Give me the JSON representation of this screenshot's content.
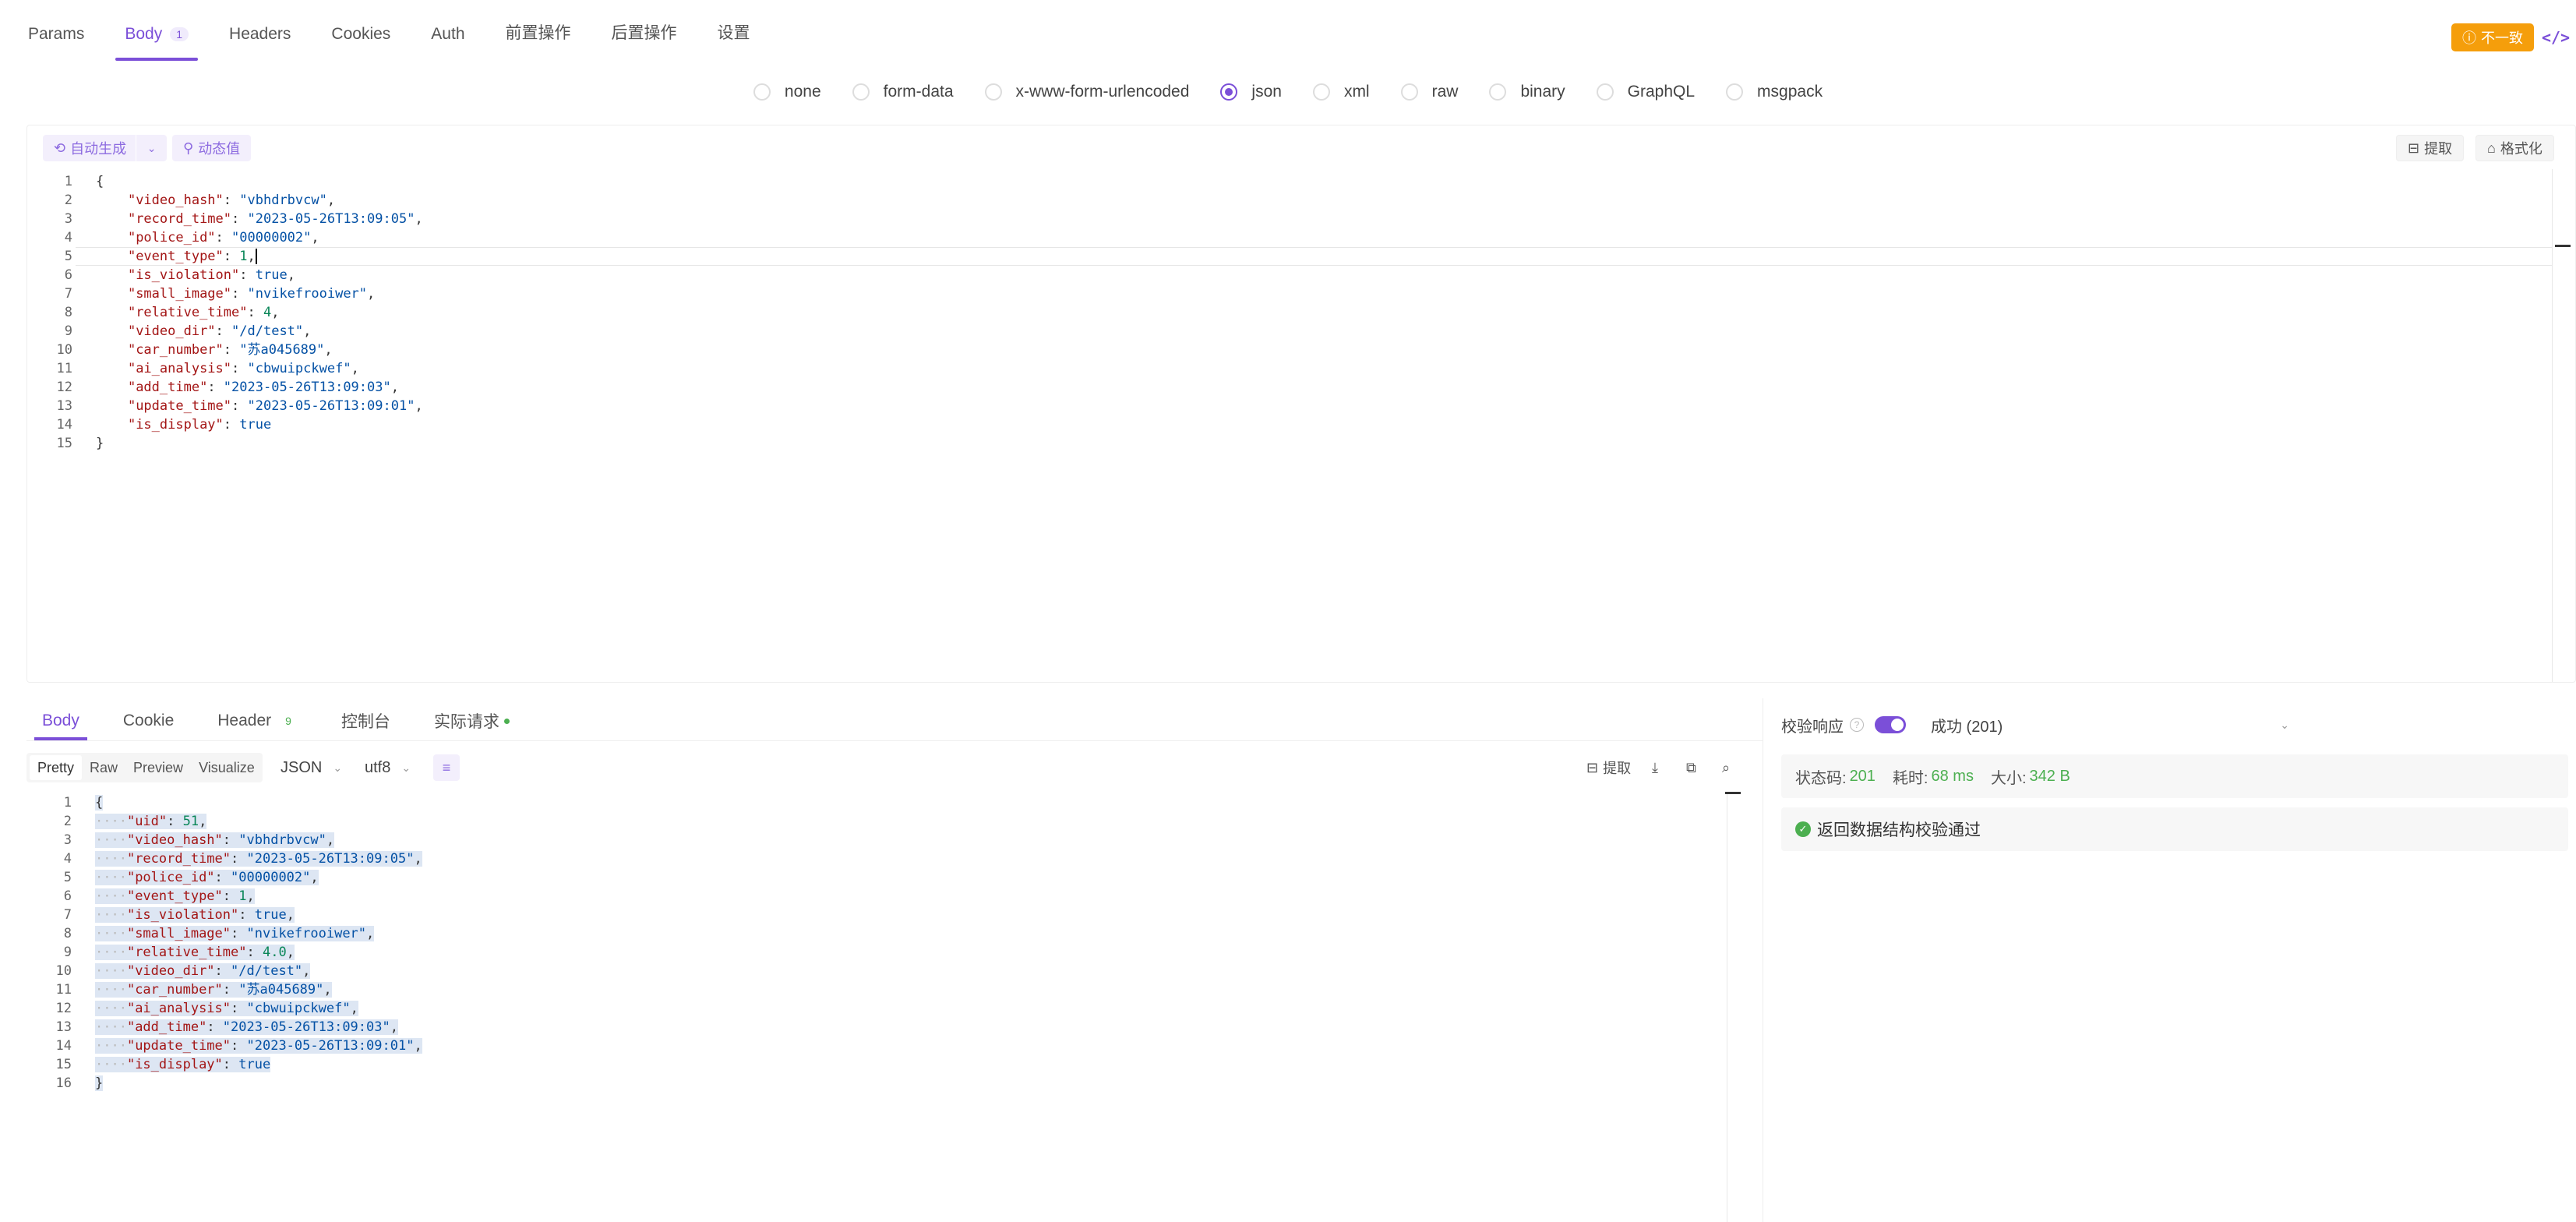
{
  "request_tabs": [
    {
      "label": "Params"
    },
    {
      "label": "Body",
      "count": "1",
      "active": true
    },
    {
      "label": "Headers"
    },
    {
      "label": "Cookies"
    },
    {
      "label": "Auth"
    },
    {
      "label": "前置操作"
    },
    {
      "label": "后置操作"
    },
    {
      "label": "设置"
    }
  ],
  "header_actions": {
    "inconsistent_label": "不一致",
    "code_icon": "code-icon"
  },
  "body_types": [
    "none",
    "form-data",
    "x-www-form-urlencoded",
    "json",
    "xml",
    "raw",
    "binary",
    "GraphQL",
    "msgpack"
  ],
  "body_type_selected": "json",
  "editor_toolbar": {
    "auto_generate": "自动生成",
    "dynamic_value": "动态值",
    "extract": "提取",
    "format": "格式化"
  },
  "request_body_lines": [
    [
      [
        "p",
        "{"
      ]
    ],
    [
      [
        "p",
        "    "
      ],
      [
        "k",
        "\"video_hash\""
      ],
      [
        "p",
        ": "
      ],
      [
        "s",
        "\"vbhdrbvcw\""
      ],
      [
        "p",
        ","
      ]
    ],
    [
      [
        "p",
        "    "
      ],
      [
        "k",
        "\"record_time\""
      ],
      [
        "p",
        ": "
      ],
      [
        "s",
        "\"2023-05-26T13:09:05\""
      ],
      [
        "p",
        ","
      ]
    ],
    [
      [
        "p",
        "    "
      ],
      [
        "k",
        "\"police_id\""
      ],
      [
        "p",
        ": "
      ],
      [
        "s",
        "\"00000002\""
      ],
      [
        "p",
        ","
      ]
    ],
    [
      [
        "p",
        "    "
      ],
      [
        "k",
        "\"event_type\""
      ],
      [
        "p",
        ": "
      ],
      [
        "n",
        "1"
      ],
      [
        "p",
        ","
      ]
    ],
    [
      [
        "p",
        "    "
      ],
      [
        "k",
        "\"is_violation\""
      ],
      [
        "p",
        ": "
      ],
      [
        "b",
        "true"
      ],
      [
        "p",
        ","
      ]
    ],
    [
      [
        "p",
        "    "
      ],
      [
        "k",
        "\"small_image\""
      ],
      [
        "p",
        ": "
      ],
      [
        "s",
        "\"nvikefrooiwer\""
      ],
      [
        "p",
        ","
      ]
    ],
    [
      [
        "p",
        "    "
      ],
      [
        "k",
        "\"relative_time\""
      ],
      [
        "p",
        ": "
      ],
      [
        "n",
        "4"
      ],
      [
        "p",
        ","
      ]
    ],
    [
      [
        "p",
        "    "
      ],
      [
        "k",
        "\"video_dir\""
      ],
      [
        "p",
        ": "
      ],
      [
        "s",
        "\"/d/test\""
      ],
      [
        "p",
        ","
      ]
    ],
    [
      [
        "p",
        "    "
      ],
      [
        "k",
        "\"car_number\""
      ],
      [
        "p",
        ": "
      ],
      [
        "s",
        "\"苏a045689\""
      ],
      [
        "p",
        ","
      ]
    ],
    [
      [
        "p",
        "    "
      ],
      [
        "k",
        "\"ai_analysis\""
      ],
      [
        "p",
        ": "
      ],
      [
        "s",
        "\"cbwuipckwef\""
      ],
      [
        "p",
        ","
      ]
    ],
    [
      [
        "p",
        "    "
      ],
      [
        "k",
        "\"add_time\""
      ],
      [
        "p",
        ": "
      ],
      [
        "s",
        "\"2023-05-26T13:09:03\""
      ],
      [
        "p",
        ","
      ]
    ],
    [
      [
        "p",
        "    "
      ],
      [
        "k",
        "\"update_time\""
      ],
      [
        "p",
        ": "
      ],
      [
        "s",
        "\"2023-05-26T13:09:01\""
      ],
      [
        "p",
        ","
      ]
    ],
    [
      [
        "p",
        "    "
      ],
      [
        "k",
        "\"is_display\""
      ],
      [
        "p",
        ": "
      ],
      [
        "b",
        "true"
      ]
    ],
    [
      [
        "p",
        "}"
      ]
    ]
  ],
  "response_tabs": [
    {
      "label": "Body",
      "active": true
    },
    {
      "label": "Cookie"
    },
    {
      "label": "Header",
      "count": "9"
    },
    {
      "label": "控制台"
    },
    {
      "label": "实际请求",
      "dot": true
    }
  ],
  "view_modes": [
    "Pretty",
    "Raw",
    "Preview",
    "Visualize"
  ],
  "format_select": "JSON",
  "encoding_select": "utf8",
  "response_tools": {
    "extract": "提取"
  },
  "response_body_lines": [
    [
      [
        "p",
        "{"
      ]
    ],
    [
      [
        "d",
        "····"
      ],
      [
        "k",
        "\"uid\""
      ],
      [
        "p",
        ": "
      ],
      [
        "n",
        "51"
      ],
      [
        "p",
        ","
      ]
    ],
    [
      [
        "d",
        "····"
      ],
      [
        "k",
        "\"video_hash\""
      ],
      [
        "p",
        ": "
      ],
      [
        "s",
        "\"vbhdrbvcw\""
      ],
      [
        "p",
        ","
      ]
    ],
    [
      [
        "d",
        "····"
      ],
      [
        "k",
        "\"record_time\""
      ],
      [
        "p",
        ": "
      ],
      [
        "s",
        "\"2023-05-26T13:09:05\""
      ],
      [
        "p",
        ","
      ]
    ],
    [
      [
        "d",
        "····"
      ],
      [
        "k",
        "\"police_id\""
      ],
      [
        "p",
        ": "
      ],
      [
        "s",
        "\"00000002\""
      ],
      [
        "p",
        ","
      ]
    ],
    [
      [
        "d",
        "····"
      ],
      [
        "k",
        "\"event_type\""
      ],
      [
        "p",
        ": "
      ],
      [
        "n",
        "1"
      ],
      [
        "p",
        ","
      ]
    ],
    [
      [
        "d",
        "····"
      ],
      [
        "k",
        "\"is_violation\""
      ],
      [
        "p",
        ": "
      ],
      [
        "b",
        "true"
      ],
      [
        "p",
        ","
      ]
    ],
    [
      [
        "d",
        "····"
      ],
      [
        "k",
        "\"small_image\""
      ],
      [
        "p",
        ": "
      ],
      [
        "s",
        "\"nvikefrooiwer\""
      ],
      [
        "p",
        ","
      ]
    ],
    [
      [
        "d",
        "····"
      ],
      [
        "k",
        "\"relative_time\""
      ],
      [
        "p",
        ": "
      ],
      [
        "n",
        "4.0"
      ],
      [
        "p",
        ","
      ]
    ],
    [
      [
        "d",
        "····"
      ],
      [
        "k",
        "\"video_dir\""
      ],
      [
        "p",
        ": "
      ],
      [
        "s",
        "\"/d/test\""
      ],
      [
        "p",
        ","
      ]
    ],
    [
      [
        "d",
        "····"
      ],
      [
        "k",
        "\"car_number\""
      ],
      [
        "p",
        ": "
      ],
      [
        "s",
        "\"苏a045689\""
      ],
      [
        "p",
        ","
      ]
    ],
    [
      [
        "d",
        "····"
      ],
      [
        "k",
        "\"ai_analysis\""
      ],
      [
        "p",
        ": "
      ],
      [
        "s",
        "\"cbwuipckwef\""
      ],
      [
        "p",
        ","
      ]
    ],
    [
      [
        "d",
        "····"
      ],
      [
        "k",
        "\"add_time\""
      ],
      [
        "p",
        ": "
      ],
      [
        "s",
        "\"2023-05-26T13:09:03\""
      ],
      [
        "p",
        ","
      ]
    ],
    [
      [
        "d",
        "····"
      ],
      [
        "k",
        "\"update_time\""
      ],
      [
        "p",
        ": "
      ],
      [
        "s",
        "\"2023-05-26T13:09:01\""
      ],
      [
        "p",
        ","
      ]
    ],
    [
      [
        "d",
        "····"
      ],
      [
        "k",
        "\"is_display\""
      ],
      [
        "p",
        ": "
      ],
      [
        "b",
        "true"
      ]
    ],
    [
      [
        "p",
        "}"
      ]
    ]
  ],
  "validation": {
    "label": "校验响应",
    "status_option": "成功 (201)",
    "status_code_label": "状态码:",
    "status_code": "201",
    "time_label": "耗时:",
    "time": "68 ms",
    "size_label": "大小:",
    "size": "342 B",
    "check_message": "返回数据结构校验通过"
  },
  "colors": {
    "accent": "#7b4fd8",
    "warning": "#f59e0b",
    "success": "#4caf50"
  }
}
